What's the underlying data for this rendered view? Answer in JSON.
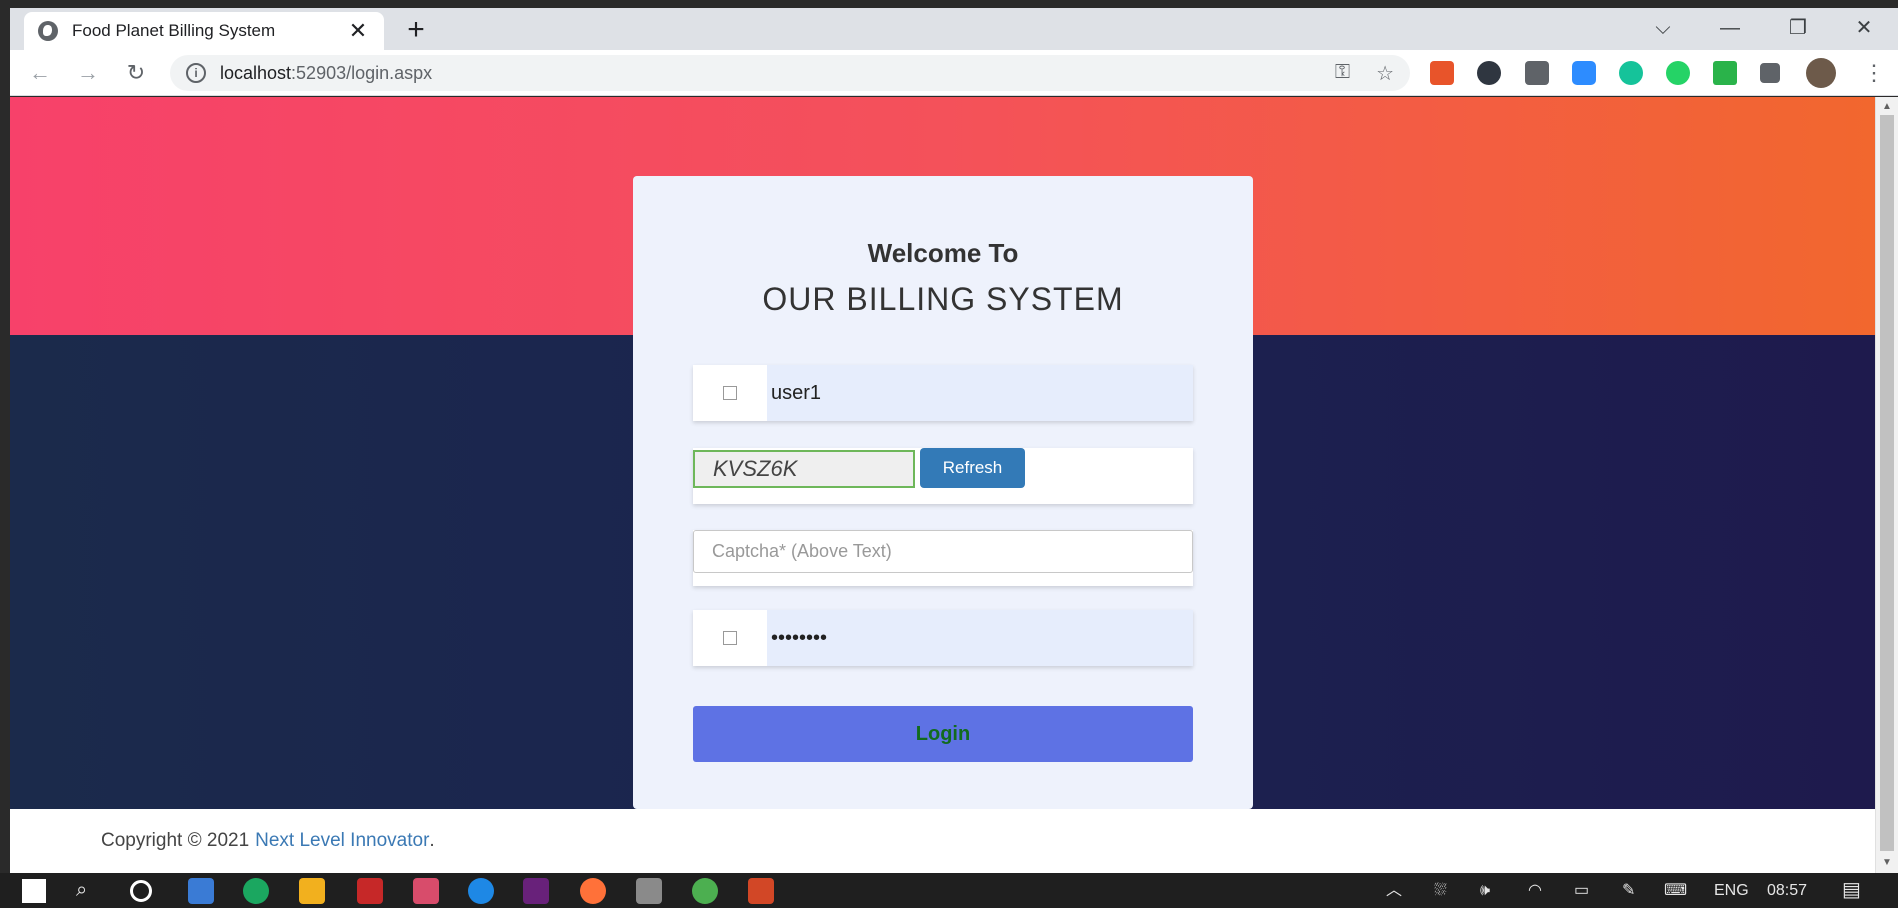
{
  "browser": {
    "tab_title": "Food Planet Billing System",
    "tab_close": "✕",
    "new_tab": "+",
    "url_host": "localhost",
    "url_path": ":52903/login.aspx",
    "minimize": "—",
    "restore": "❐",
    "close": "✕",
    "tab_search": "⌵"
  },
  "login": {
    "welcome": "Welcome To",
    "heading": "OUR BILLING SYSTEM",
    "username_value": "user1",
    "captcha_text": "KVSZ6K",
    "refresh_label": "Refresh",
    "captcha_placeholder": "Captcha* (Above Text)",
    "password_value": "••••••••",
    "login_label": "Login"
  },
  "footer": {
    "copyright": "Copyright © 2021",
    "link_text": "Next Level Innovator",
    "period": "."
  },
  "taskbar": {
    "language": "ENG",
    "time": "08:57"
  },
  "colors": {
    "hero_gradient_start": "#f7416a",
    "hero_gradient_end": "#f2672e",
    "dark_band": "#1b2350",
    "card_bg": "#eef2fc",
    "login_button": "#5e72e4",
    "login_text": "#116b1d",
    "refresh_button": "#337ab7",
    "captcha_border": "#6eb75a"
  }
}
